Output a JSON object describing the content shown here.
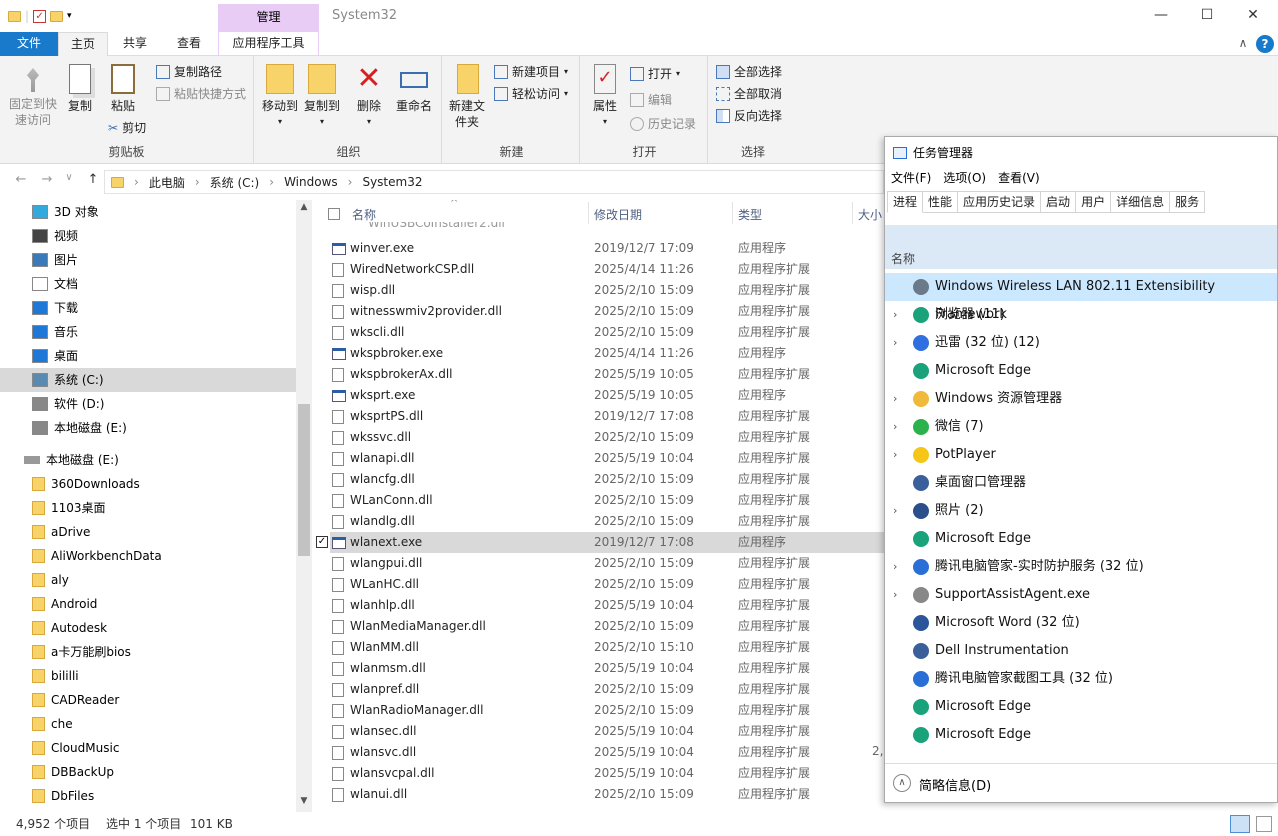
{
  "titlebar": {
    "manage_label": "管理",
    "window_title": "System32",
    "min": "—",
    "max": "☐",
    "close": "✕"
  },
  "tabs": {
    "file": "文件",
    "home": "主页",
    "share": "共享",
    "view": "查看",
    "apptools": "应用程序工具",
    "collapse": "∧",
    "help": "?"
  },
  "ribbon": {
    "clipboard": {
      "pin": "固定到快速访问",
      "copy": "复制",
      "paste": "粘贴",
      "copy_path": "复制路径",
      "paste_shortcut": "粘贴快捷方式",
      "cut": "剪切",
      "label": "剪贴板"
    },
    "organize": {
      "move": "移动到",
      "copyto": "复制到",
      "delete": "删除",
      "rename": "重命名",
      "label": "组织"
    },
    "new": {
      "new_folder": "新建文件夹",
      "new_item": "新建项目",
      "easy_access": "轻松访问",
      "label": "新建"
    },
    "open": {
      "props": "属性",
      "open": "打开",
      "edit": "编辑",
      "history": "历史记录",
      "label": "打开"
    },
    "select": {
      "all": "全部选择",
      "none": "全部取消",
      "invert": "反向选择",
      "label": "选择"
    }
  },
  "address": {
    "back": "←",
    "fwd": "→",
    "down": "∨",
    "up": "↑",
    "crumbs": [
      "此电脑",
      "系统 (C:)",
      "Windows",
      "System32"
    ]
  },
  "nav": [
    "3D 对象",
    "视频",
    "图片",
    "文档",
    "下载",
    "音乐",
    "桌面",
    "系统 (C:)",
    "软件 (D:)",
    "本地磁盘 (E:)",
    "本地磁盘 (E:)",
    "360Downloads",
    "1103桌面",
    "aDrive",
    "AliWorkbenchData",
    "aly",
    "Android",
    "Autodesk",
    "a卡万能刷bios",
    "bililli",
    "CADReader",
    "che",
    "CloudMusic",
    "DBBackUp",
    "DbFiles"
  ],
  "list": {
    "headers": {
      "name": "名称",
      "date": "修改日期",
      "type": "类型",
      "size": "大小"
    },
    "partial_top": "WinUSBCoInstaller2.dll",
    "rows": [
      [
        "winver.exe",
        "2019/12/7 17:09",
        "应用程序",
        "exe"
      ],
      [
        "WiredNetworkCSP.dll",
        "2025/4/14 11:26",
        "应用程序扩展",
        "dll"
      ],
      [
        "wisp.dll",
        "2025/2/10 15:09",
        "应用程序扩展",
        "dll"
      ],
      [
        "witnesswmiv2provider.dll",
        "2025/2/10 15:09",
        "应用程序扩展",
        "dll"
      ],
      [
        "wkscli.dll",
        "2025/2/10 15:09",
        "应用程序扩展",
        "dll"
      ],
      [
        "wkspbroker.exe",
        "2025/4/14 11:26",
        "应用程序",
        "exe"
      ],
      [
        "wkspbrokerAx.dll",
        "2025/5/19 10:05",
        "应用程序扩展",
        "dll"
      ],
      [
        "wksprt.exe",
        "2025/5/19 10:05",
        "应用程序",
        "exe"
      ],
      [
        "wksprtPS.dll",
        "2019/12/7 17:08",
        "应用程序扩展",
        "dll"
      ],
      [
        "wkssvc.dll",
        "2025/2/10 15:09",
        "应用程序扩展",
        "dll"
      ],
      [
        "wlanapi.dll",
        "2025/5/19 10:04",
        "应用程序扩展",
        "dll"
      ],
      [
        "wlancfg.dll",
        "2025/2/10 15:09",
        "应用程序扩展",
        "dll"
      ],
      [
        "WLanConn.dll",
        "2025/2/10 15:09",
        "应用程序扩展",
        "dll"
      ],
      [
        "wlandlg.dll",
        "2025/2/10 15:09",
        "应用程序扩展",
        "dll"
      ],
      [
        "wlanext.exe",
        "2019/12/7 17:08",
        "应用程序",
        "exe"
      ],
      [
        "wlangpui.dll",
        "2025/2/10 15:09",
        "应用程序扩展",
        "dll"
      ],
      [
        "WLanHC.dll",
        "2025/2/10 15:09",
        "应用程序扩展",
        "dll"
      ],
      [
        "wlanhlp.dll",
        "2025/5/19 10:04",
        "应用程序扩展",
        "dll"
      ],
      [
        "WlanMediaManager.dll",
        "2025/2/10 15:09",
        "应用程序扩展",
        "dll"
      ],
      [
        "WlanMM.dll",
        "2025/2/10 15:10",
        "应用程序扩展",
        "dll"
      ],
      [
        "wlanmsm.dll",
        "2025/5/19 10:04",
        "应用程序扩展",
        "dll"
      ],
      [
        "wlanpref.dll",
        "2025/2/10 15:09",
        "应用程序扩展",
        "dll"
      ],
      [
        "WlanRadioManager.dll",
        "2025/2/10 15:09",
        "应用程序扩展",
        "dll"
      ],
      [
        "wlansec.dll",
        "2025/5/19 10:04",
        "应用程序扩展",
        "dll"
      ],
      [
        "wlansvc.dll",
        "2025/5/19 10:04",
        "应用程序扩展",
        "dll"
      ],
      [
        "wlansvcpal.dll",
        "2025/5/19 10:04",
        "应用程序扩展",
        "dll"
      ],
      [
        "wlanui.dll",
        "2025/2/10 15:09",
        "应用程序扩展",
        "dll"
      ]
    ],
    "size_partial": "2,"
  },
  "status": {
    "count": "4,952 个项目",
    "selected": "选中 1 个项目",
    "size": "101 KB"
  },
  "taskmgr": {
    "title": "任务管理器",
    "menu": [
      "文件(F)",
      "选项(O)",
      "查看(V)"
    ],
    "tabs": [
      "进程",
      "性能",
      "应用历史记录",
      "启动",
      "用户",
      "详细信息",
      "服务"
    ],
    "col_name": "名称",
    "procs": [
      [
        "Windows Wireless LAN 802.11 Extensibility Framework",
        "",
        "#6a7a8a"
      ],
      [
        "浏览器 (11)",
        "›",
        "#1aa37a"
      ],
      [
        "迅雷 (32 位) (12)",
        "›",
        "#2f6fe0"
      ],
      [
        "Microsoft Edge",
        "",
        "#1aa37a"
      ],
      [
        "Windows 资源管理器",
        "›",
        "#f0b93a"
      ],
      [
        "微信 (7)",
        "›",
        "#2bb24c"
      ],
      [
        "PotPlayer",
        "›",
        "#f5c518"
      ],
      [
        "桌面窗口管理器",
        "",
        "#3a5f9a"
      ],
      [
        "照片 (2)",
        "›",
        "#2a4f8a"
      ],
      [
        "Microsoft Edge",
        "",
        "#1aa37a"
      ],
      [
        "腾讯电脑管家-实时防护服务 (32 位)",
        "›",
        "#2a6fd6"
      ],
      [
        "SupportAssistAgent.exe",
        "›",
        "#888888"
      ],
      [
        "Microsoft Word (32 位)",
        "",
        "#2b579a"
      ],
      [
        "Dell Instrumentation",
        "",
        "#3a5f9a"
      ],
      [
        "腾讯电脑管家截图工具 (32 位)",
        "",
        "#2a6fd6"
      ],
      [
        "Microsoft Edge",
        "",
        "#1aa37a"
      ],
      [
        "Microsoft Edge",
        "",
        "#1aa37a"
      ]
    ],
    "fewer_details": "简略信息(D)"
  }
}
